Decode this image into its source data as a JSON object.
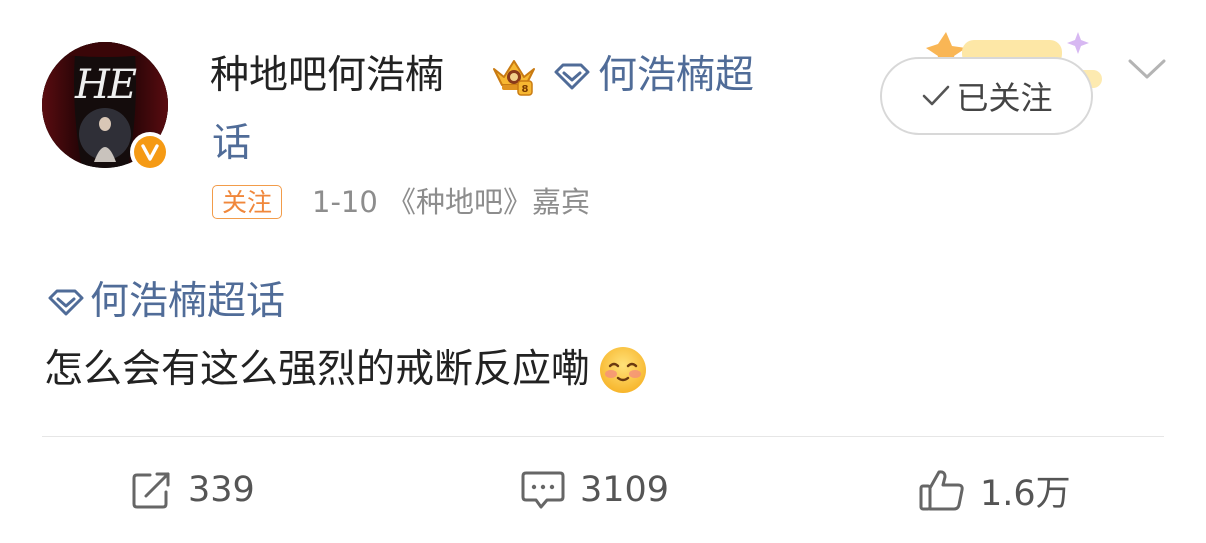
{
  "post": {
    "author": {
      "name": "种地吧何浩楠",
      "topic_link": "何浩楠超",
      "topic_link_wrap": "话",
      "tag": "关注",
      "meta": "1-10 《种地吧》嘉宾",
      "avatar_text": "HE",
      "verified_symbol": "V"
    },
    "follow_button": {
      "label": "已关注",
      "icon": "checkmark-icon"
    },
    "menu_icon": "chevron-down-icon",
    "topic": "何浩楠超话",
    "content": "怎么会有这么强烈的戒断反应嘞",
    "emoji": "shy-face-emoji"
  },
  "actions": {
    "repost": {
      "count": "339",
      "icon": "repost-icon"
    },
    "comment": {
      "count": "3109",
      "icon": "comment-icon"
    },
    "like": {
      "count": "1.6万",
      "icon": "thumbs-up-icon"
    }
  },
  "colors": {
    "topic_blue": "#506c98",
    "tag_orange": "#f0873b",
    "meta_gray": "#8d8d8d",
    "verified_orange": "#f59a14"
  }
}
